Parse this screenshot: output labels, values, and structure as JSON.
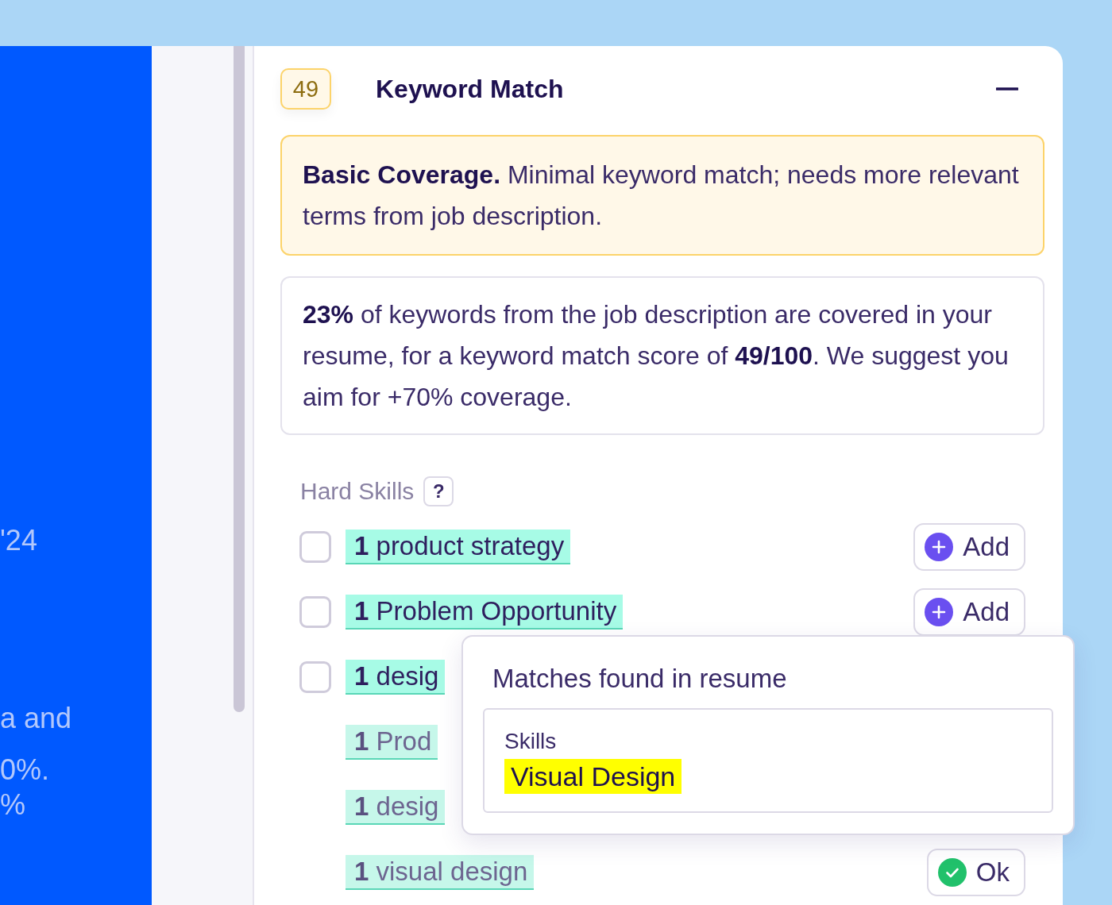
{
  "sidebar": {
    "texts": [
      "'24",
      "a and",
      "0%.",
      "%"
    ]
  },
  "card": {
    "score": "49",
    "title": "Keyword Match",
    "expanded": true,
    "rating": "**Basic Coverage.** Minimal keyword match; needs more relevant terms from job description.",
    "summary": "**23%** of keywords from the job description are covered in your resume, for a keyword match score of **49/100**. We suggest you aim for +70% coverage.",
    "section": {
      "title": "Hard Skills",
      "help": "?"
    },
    "skills": [
      {
        "kind": "missing",
        "checked": false,
        "count": "1",
        "keyword": "product strategy",
        "action": {
          "kind": "add",
          "label": "Add"
        }
      },
      {
        "kind": "missing",
        "checked": false,
        "count": "1",
        "keyword": "Problem Opportunity",
        "action": {
          "kind": "add",
          "label": "Add"
        }
      },
      {
        "kind": "missing",
        "checked": false,
        "count": "1",
        "keyword": "desig"
      },
      {
        "kind": "found",
        "count": "1",
        "keyword": "Prod"
      },
      {
        "kind": "found",
        "count": "1",
        "keyword": "desig"
      },
      {
        "kind": "found",
        "count": "1",
        "keyword": "visual design",
        "action": {
          "kind": "ok",
          "label": "Ok"
        }
      }
    ],
    "popover": {
      "title": "Matches found in resume",
      "groups": [
        {
          "label": "Skills",
          "match": "Visual Design"
        }
      ]
    }
  }
}
